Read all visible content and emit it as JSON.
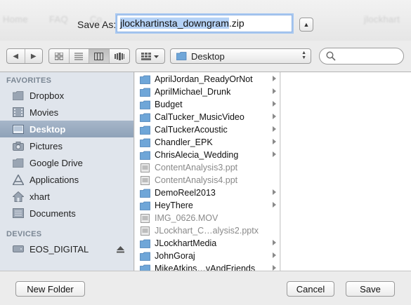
{
  "background_nav": [
    "Home",
    "FAQ",
    "Co",
    "jlockhart"
  ],
  "save_as": {
    "label": "Save As:",
    "filename_selected": "jlockhartinsta_downgram",
    "filename_ext": ".zip"
  },
  "toolbar": {
    "location": "Desktop",
    "search_placeholder": ""
  },
  "sidebar": {
    "favorites_header": "FAVORITES",
    "favorites": [
      {
        "label": "Dropbox",
        "icon": "folder-icon"
      },
      {
        "label": "Movies",
        "icon": "film-icon"
      },
      {
        "label": "Desktop",
        "icon": "desktop-icon",
        "selected": true
      },
      {
        "label": "Pictures",
        "icon": "camera-icon"
      },
      {
        "label": "Google Drive",
        "icon": "folder-icon"
      },
      {
        "label": "Applications",
        "icon": "applications-icon"
      },
      {
        "label": "xhart",
        "icon": "home-icon"
      },
      {
        "label": "Documents",
        "icon": "documents-icon"
      }
    ],
    "devices_header": "DEVICES",
    "devices": [
      {
        "label": "EOS_DIGITAL",
        "icon": "drive-icon"
      }
    ]
  },
  "files": [
    {
      "name": "AprilJordan_ReadyOrNot",
      "kind": "folder"
    },
    {
      "name": "AprilMichael_Drunk",
      "kind": "folder"
    },
    {
      "name": "Budget",
      "kind": "folder"
    },
    {
      "name": "CalTucker_MusicVideo",
      "kind": "folder"
    },
    {
      "name": "CalTuckerAcoustic",
      "kind": "folder"
    },
    {
      "name": "Chandler_EPK",
      "kind": "folder"
    },
    {
      "name": "ChrisAlecia_Wedding",
      "kind": "folder"
    },
    {
      "name": "ContentAnalysis3.ppt",
      "kind": "doc"
    },
    {
      "name": "ContentAnalysis4.ppt",
      "kind": "doc"
    },
    {
      "name": "DemoReel2013",
      "kind": "folder"
    },
    {
      "name": "HeyThere",
      "kind": "folder"
    },
    {
      "name": "IMG_0626.MOV",
      "kind": "doc"
    },
    {
      "name": "JLockhart_C…alysis2.pptx",
      "kind": "doc"
    },
    {
      "name": "JLockhartMedia",
      "kind": "folder"
    },
    {
      "name": "JohnGoraj",
      "kind": "folder"
    },
    {
      "name": "MikeAtkins…vAndFriends",
      "kind": "folder"
    }
  ],
  "buttons": {
    "new_folder": "New Folder",
    "cancel": "Cancel",
    "save": "Save"
  },
  "colors": {
    "sidebar_bg": "#e0e5ec",
    "selection": "#8fa2b8",
    "folder": "#6fa6d8"
  }
}
